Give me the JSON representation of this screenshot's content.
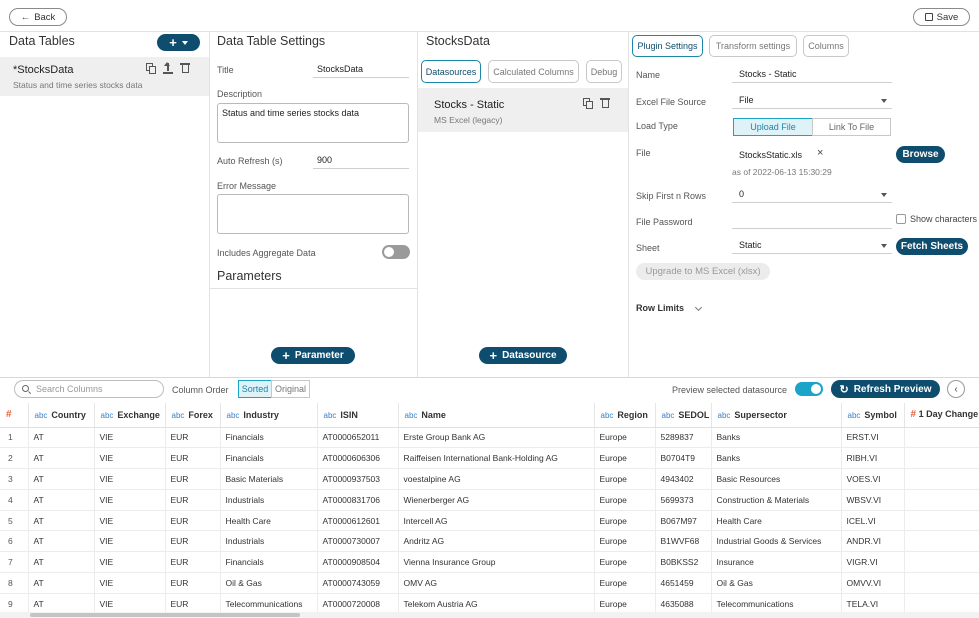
{
  "topbar": {
    "back_label": "Back",
    "save_label": "Save"
  },
  "data_tables": {
    "title": "Data Tables",
    "items": [
      {
        "name": "*StocksData",
        "description": "Status and time series stocks data"
      }
    ]
  },
  "settings": {
    "title": "Data Table Settings",
    "title_label": "Title",
    "title_value": "StocksData",
    "description_label": "Description",
    "description_value": "Status and time series stocks data",
    "auto_refresh_label": "Auto Refresh (s)",
    "auto_refresh_value": "900",
    "error_label": "Error Message",
    "error_value": "",
    "aggregate_label": "Includes Aggregate Data",
    "aggregate_on": false,
    "parameters_title": "Parameters",
    "add_parameter_label": "Parameter"
  },
  "datasources": {
    "title": "StocksData",
    "tabs": [
      "Datasources",
      "Calculated Columns",
      "Debug"
    ],
    "active_tab": 0,
    "items": [
      {
        "name": "Stocks - Static",
        "type": "MS Excel (legacy)"
      }
    ],
    "add_label": "Datasource"
  },
  "plugin": {
    "tabs": [
      "Plugin Settings",
      "Transform settings",
      "Columns"
    ],
    "name_label": "Name",
    "name_value": "Stocks - Static",
    "source_label": "Excel File Source",
    "source_value": "File",
    "load_type_label": "Load Type",
    "load_options": [
      "Upload File",
      "Link To File"
    ],
    "file_label": "File",
    "file_name": "StocksStatic.xls",
    "file_date": "as of 2022-06-13 15:30:29",
    "browse_label": "Browse",
    "skip_label": "Skip First n Rows",
    "skip_value": "0",
    "password_label": "File Password",
    "show_chars_label": "Show characters",
    "sheet_label": "Sheet",
    "sheet_value": "Static",
    "fetch_label": "Fetch Sheets",
    "upgrade_label": "Upgrade to MS Excel (xlsx)",
    "row_limits_label": "Row Limits"
  },
  "preview": {
    "search_placeholder": "Search Columns",
    "column_order_label": "Column Order",
    "order_options": [
      "Sorted",
      "Original"
    ],
    "preview_label": "Preview selected datasource",
    "preview_on": true,
    "refresh_label": "Refresh Preview",
    "columns": [
      {
        "type": "#",
        "name": ""
      },
      {
        "type": "abc",
        "name": "Country"
      },
      {
        "type": "abc",
        "name": "Exchange"
      },
      {
        "type": "abc",
        "name": "Forex"
      },
      {
        "type": "abc",
        "name": "Industry"
      },
      {
        "type": "abc",
        "name": "ISIN"
      },
      {
        "type": "abc",
        "name": "Name"
      },
      {
        "type": "abc",
        "name": "Region"
      },
      {
        "type": "abc",
        "name": "SEDOL"
      },
      {
        "type": "abc",
        "name": "Supersector"
      },
      {
        "type": "abc",
        "name": "Symbol"
      },
      {
        "type": "#",
        "name": "1 Day Change"
      }
    ],
    "rows": [
      [
        "1",
        "AT",
        "VIE",
        "EUR",
        "Financials",
        "AT0000652011",
        "Erste Group Bank AG",
        "Europe",
        "5289837",
        "Banks",
        "ERST.VI",
        ""
      ],
      [
        "2",
        "AT",
        "VIE",
        "EUR",
        "Financials",
        "AT0000606306",
        "Raiffeisen International Bank-Holding AG",
        "Europe",
        "B0704T9",
        "Banks",
        "RIBH.VI",
        ""
      ],
      [
        "3",
        "AT",
        "VIE",
        "EUR",
        "Basic Materials",
        "AT0000937503",
        "voestalpine AG",
        "Europe",
        "4943402",
        "Basic Resources",
        "VOES.VI",
        ""
      ],
      [
        "4",
        "AT",
        "VIE",
        "EUR",
        "Industrials",
        "AT0000831706",
        "Wienerberger AG",
        "Europe",
        "5699373",
        "Construction & Materials",
        "WBSV.VI",
        ""
      ],
      [
        "5",
        "AT",
        "VIE",
        "EUR",
        "Health Care",
        "AT0000612601",
        "Intercell AG",
        "Europe",
        "B067M97",
        "Health Care",
        "ICEL.VI",
        ""
      ],
      [
        "6",
        "AT",
        "VIE",
        "EUR",
        "Industrials",
        "AT0000730007",
        "Andritz AG",
        "Europe",
        "B1WVF68",
        "Industrial Goods & Services",
        "ANDR.VI",
        ""
      ],
      [
        "7",
        "AT",
        "VIE",
        "EUR",
        "Financials",
        "AT0000908504",
        "Vienna Insurance Group",
        "Europe",
        "B0BKSS2",
        "Insurance",
        "VIGR.VI",
        ""
      ],
      [
        "8",
        "AT",
        "VIE",
        "EUR",
        "Oil & Gas",
        "AT0000743059",
        "OMV AG",
        "Europe",
        "4651459",
        "Oil & Gas",
        "OMVV.VI",
        ""
      ],
      [
        "9",
        "AT",
        "VIE",
        "EUR",
        "Telecommunications",
        "AT0000720008",
        "Telekom Austria AG",
        "Europe",
        "4635088",
        "Telecommunications",
        "TELA.VI",
        ""
      ]
    ]
  },
  "colors": {
    "accent": "#0e4d6e",
    "highlight": "#1aa4c8",
    "number_type": "#e0633c",
    "text_type": "#3a82c4"
  }
}
